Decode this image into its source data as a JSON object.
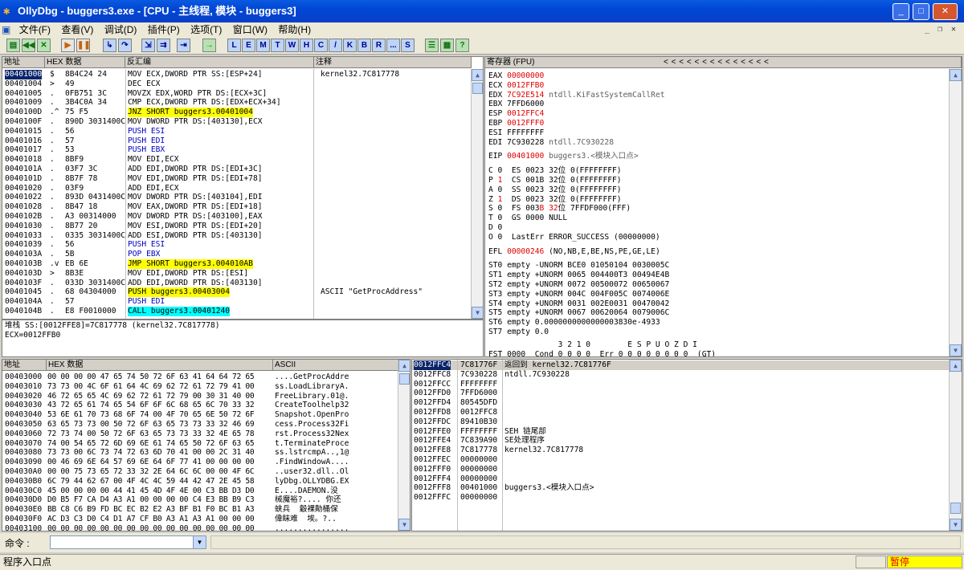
{
  "window": {
    "title": "OllyDbg - buggers3.exe - [CPU - 主线程, 模块 - buggers3]"
  },
  "menu": [
    "文件(F)",
    "查看(V)",
    "调试(D)",
    "插件(P)",
    "选项(T)",
    "窗口(W)",
    "帮助(H)"
  ],
  "toolbar_letters": [
    "L",
    "E",
    "M",
    "T",
    "W",
    "H",
    "C",
    "/",
    "K",
    "B",
    "R",
    "...",
    "S"
  ],
  "disasm": {
    "headers": {
      "addr": "地址",
      "hex": "HEX 数据",
      "dis": "反汇编",
      "cmt": "注释"
    },
    "rows": [
      {
        "addr": "00401000",
        "mk": "$",
        "hex": "8B4C24 24",
        "dis": "MOV ECX,DWORD PTR SS:[ESP+24]",
        "cmt": "kernel32.7C817778",
        "sel": true
      },
      {
        "addr": "00401004",
        "mk": ">",
        "hex": "49",
        "dis": "DEC ECX",
        "cmt": ""
      },
      {
        "addr": "00401005",
        "mk": ".",
        "hex": "0FB751 3C",
        "dis": "MOVZX EDX,WORD PTR DS:[ECX+3C]",
        "cmt": ""
      },
      {
        "addr": "00401009",
        "mk": ".",
        "hex": "3B4C0A 34",
        "dis": "CMP ECX,DWORD PTR DS:[EDX+ECX+34]",
        "cmt": ""
      },
      {
        "addr": "0040100D",
        "mk": ".^",
        "hex": "75 F5",
        "dis": "JNZ SHORT buggers3.00401004",
        "cmt": "",
        "hl": "y"
      },
      {
        "addr": "0040100F",
        "mk": ".",
        "hex": "890D 3031400C",
        "dis": "MOV DWORD PTR DS:[403130],ECX",
        "cmt": ""
      },
      {
        "addr": "00401015",
        "mk": ".",
        "hex": "56",
        "dis": "PUSH ESI",
        "cmt": "",
        "blue": true
      },
      {
        "addr": "00401016",
        "mk": ".",
        "hex": "57",
        "dis": "PUSH EDI",
        "cmt": "",
        "blue": true
      },
      {
        "addr": "00401017",
        "mk": ".",
        "hex": "53",
        "dis": "PUSH EBX",
        "cmt": "",
        "blue": true
      },
      {
        "addr": "00401018",
        "mk": ".",
        "hex": "8BF9",
        "dis": "MOV EDI,ECX",
        "cmt": ""
      },
      {
        "addr": "0040101A",
        "mk": ".",
        "hex": "03F7 3C",
        "dis": "ADD EDI,DWORD PTR DS:[EDI+3C]",
        "cmt": ""
      },
      {
        "addr": "0040101D",
        "mk": ".",
        "hex": "8B7F 78",
        "dis": "MOV EDI,DWORD PTR DS:[EDI+78]",
        "cmt": ""
      },
      {
        "addr": "00401020",
        "mk": ".",
        "hex": "03F9",
        "dis": "ADD EDI,ECX",
        "cmt": ""
      },
      {
        "addr": "00401022",
        "mk": ".",
        "hex": "893D 0431400C",
        "dis": "MOV DWORD PTR DS:[403104],EDI",
        "cmt": ""
      },
      {
        "addr": "00401028",
        "mk": ".",
        "hex": "8B47 18",
        "dis": "MOV EAX,DWORD PTR DS:[EDI+18]",
        "cmt": ""
      },
      {
        "addr": "0040102B",
        "mk": ".",
        "hex": "A3 00314000",
        "dis": "MOV DWORD PTR DS:[403100],EAX",
        "cmt": ""
      },
      {
        "addr": "00401030",
        "mk": ".",
        "hex": "8B77 20",
        "dis": "MOV ESI,DWORD PTR DS:[EDI+20]",
        "cmt": ""
      },
      {
        "addr": "00401033",
        "mk": ".",
        "hex": "0335 3031400C",
        "dis": "ADD ESI,DWORD PTR DS:[403130]",
        "cmt": ""
      },
      {
        "addr": "00401039",
        "mk": ".",
        "hex": "56",
        "dis": "PUSH ESI",
        "cmt": "",
        "blue": true
      },
      {
        "addr": "0040103A",
        "mk": ".",
        "hex": "5B",
        "dis": "POP EBX",
        "cmt": "",
        "blue": true
      },
      {
        "addr": "0040103B",
        "mk": ".v",
        "hex": "EB 6E",
        "dis": "JMP SHORT buggers3.004010AB",
        "cmt": "",
        "hl": "y"
      },
      {
        "addr": "0040103D",
        "mk": ">",
        "hex": "8B3E",
        "dis": "MOV EDI,DWORD PTR DS:[ESI]",
        "cmt": ""
      },
      {
        "addr": "0040103F",
        "mk": ".",
        "hex": "033D 3031400C",
        "dis": "ADD EDI,DWORD PTR DS:[403130]",
        "cmt": ""
      },
      {
        "addr": "00401045",
        "mk": ".",
        "hex": "68 04304000",
        "dis": "PUSH buggers3.00403004",
        "cmt": "ASCII \"GetProcAddress\"",
        "hl": "yp"
      },
      {
        "addr": "0040104A",
        "mk": ".",
        "hex": "57",
        "dis": "PUSH EDI",
        "cmt": "",
        "blue": true
      },
      {
        "addr": "0040104B",
        "mk": ".",
        "hex": "E8 F0010000",
        "dis": "CALL buggers3.00401240",
        "cmt": "",
        "hl": "c"
      }
    ]
  },
  "info": {
    "line1": "堆栈 SS:[0012FFE8]=7C817778 (kernel32.7C817778)",
    "line2": "ECX=0012FFB0"
  },
  "registers": {
    "header": "寄存器 (FPU)",
    "nav": "<   <   <   <   <   <   <   <   <   <   <   <   <   <",
    "gp": [
      {
        "n": "EAX",
        "v": "00000000",
        "c": "",
        "r": true
      },
      {
        "n": "ECX",
        "v": "0012FFB0",
        "c": "",
        "r": true
      },
      {
        "n": "EDX",
        "v": "7C92E514",
        "c": "ntdll.KiFastSystemCallRet",
        "r": true
      },
      {
        "n": "EBX",
        "v": "7FFD6000",
        "c": "",
        "r": false
      },
      {
        "n": "ESP",
        "v": "0012FFC4",
        "c": "",
        "r": true
      },
      {
        "n": "EBP",
        "v": "0012FFF0",
        "c": "",
        "r": true
      },
      {
        "n": "ESI",
        "v": "FFFFFFFF",
        "c": "",
        "r": false
      },
      {
        "n": "EDI",
        "v": "7C930228",
        "c": "ntdll.7C930228",
        "r": false
      }
    ],
    "eip": {
      "n": "EIP",
      "v": "00401000",
      "c": "buggers3.<模块入口点>"
    },
    "flags": [
      "C 0  ES 0023 32位 0(FFFFFFFF)",
      "P 1  CS 001B 32位 0(FFFFFFFF)",
      "A 0  SS 0023 32位 0(FFFFFFFF)",
      "Z 1  DS 0023 32位 0(FFFFFFFF)",
      "S 0  FS 003B 32位 7FFDF000(FFF)",
      "T 0  GS 0000 NULL",
      "D 0",
      "O 0  LastErr ERROR_SUCCESS (00000000)"
    ],
    "efl": {
      "n": "EFL",
      "v": "00000246",
      "c": "(NO,NB,E,BE,NS,PE,GE,LE)"
    },
    "fpu": [
      "ST0 empty -UNORM BCE0 01050104 0030005C",
      "ST1 empty +UNORM 0065 004400T3 00494E4B",
      "ST2 empty +UNORM 0072 00500072 00650067",
      "ST3 empty +UNORM 004C 004F005C 0074006E",
      "ST4 empty +UNORM 0031 002E0031 00470042",
      "ST5 empty +UNORM 0067 00620064 0079006C",
      "ST6 empty 0.0000000000000003830e-4933",
      "ST7 empty 0.0"
    ],
    "fst_top": "               3 2 1 0        E S P U O Z D I",
    "fst": "FST 0000  Cond 0 0 0 0  Err 0 0 0 0 0 0 0 0  (GT)"
  },
  "dump": {
    "headers": {
      "addr": "地址",
      "hex": "HEX 数据",
      "ascii": "ASCII"
    },
    "rows": [
      {
        "a": "00403000",
        "h": "00 00 00 00 47 65 74 50 72 6F 63 41 64 64 72 65",
        "s": "....GetProcAddre"
      },
      {
        "a": "00403010",
        "h": "73 73 00 4C 6F 61 64 4C 69 62 72 61 72 79 41 00",
        "s": "ss.LoadLibraryA."
      },
      {
        "a": "00403020",
        "h": "46 72 65 65 4C 69 62 72 61 72 79 00 30 31 40 00",
        "s": "FreeLibrary.01@."
      },
      {
        "a": "00403030",
        "h": "43 72 65 61 74 65 54 6F 6F 6C 68 65 6C 70 33 32",
        "s": "CreateToolhelp32"
      },
      {
        "a": "00403040",
        "h": "53 6E 61 70 73 68 6F 74 00 4F 70 65 6E 50 72 6F",
        "s": "Snapshot.OpenPro"
      },
      {
        "a": "00403050",
        "h": "63 65 73 73 00 50 72 6F 63 65 73 73 33 32 46 69",
        "s": "cess.Process32Fi"
      },
      {
        "a": "00403060",
        "h": "72 73 74 00 50 72 6F 63 65 73 73 33 32 4E 65 78",
        "s": "rst.Process32Nex"
      },
      {
        "a": "00403070",
        "h": "74 00 54 65 72 6D 69 6E 61 74 65 50 72 6F 63 65",
        "s": "t.TerminateProce"
      },
      {
        "a": "00403080",
        "h": "73 73 00 6C 73 74 72 63 6D 70 41 00 00 2C 31 40",
        "s": "ss.lstrcmpA..,1@"
      },
      {
        "a": "00403090",
        "h": "00 46 69 6E 64 57 69 6E 64 6F 77 41 00 00 00 00",
        "s": ".FindWindowA...."
      },
      {
        "a": "004030A0",
        "h": "00 00 75 73 65 72 33 32 2E 64 6C 6C 00 00 4F 6C",
        "s": "..user32.dll..Ol"
      },
      {
        "a": "004030B0",
        "h": "6C 79 44 62 67 00 4F 4C 4C 59 44 42 47 2E 45 58",
        "s": "lyDbg.OLLYDBG.EX"
      },
      {
        "a": "004030C0",
        "h": "45 00 00 00 00 44 41 45 4D 4F 4E 00 C3 BB D3 D0",
        "s": "E....DAEMON.没"
      },
      {
        "a": "004030D0",
        "h": "D0 B5 F7 CA D4 A3 A1 00 00 00 00 C4 E3 BB B9 C3",
        "s": "械魔裕?.... 你还"
      },
      {
        "a": "004030E0",
        "h": "BB C8 C6 B9 FD BC EC B2 E2 A3 BF B1 F0 BC B1 A3",
        "s": "蛱兵  觳裸勣桶保"
      },
      {
        "a": "004030F0",
        "h": "AC D3 C3 D0 C4 D1 A7 CF B0 A3 A1 A3 A1 00 00 00",
        "s": "偉眛难  埃。?.."
      },
      {
        "a": "00403100",
        "h": "00 00 00 00 00 00 00 00 00 00 00 00 00 00 00 00",
        "s": "................"
      }
    ]
  },
  "stack": {
    "rows": [
      {
        "a": "0012FFC4",
        "v": "7C81776F",
        "c": "返回到 kernel32.7C81776F",
        "sel": true
      },
      {
        "a": "0012FFC8",
        "v": "7C930228",
        "c": "ntdll.7C930228"
      },
      {
        "a": "0012FFCC",
        "v": "FFFFFFFF",
        "c": ""
      },
      {
        "a": "0012FFD0",
        "v": "7FFD6000",
        "c": ""
      },
      {
        "a": "0012FFD4",
        "v": "80545DFD",
        "c": ""
      },
      {
        "a": "0012FFD8",
        "v": "0012FFC8",
        "c": ""
      },
      {
        "a": "0012FFDC",
        "v": "89410B30",
        "c": ""
      },
      {
        "a": "0012FFE0",
        "v": "FFFFFFFF",
        "c": "SEH 链尾部"
      },
      {
        "a": "0012FFE4",
        "v": "7C839A90",
        "c": "SE处理程序"
      },
      {
        "a": "0012FFE8",
        "v": "7C817778",
        "c": "kernel32.7C817778"
      },
      {
        "a": "0012FFEC",
        "v": "00000000",
        "c": ""
      },
      {
        "a": "0012FFF0",
        "v": "00000000",
        "c": ""
      },
      {
        "a": "0012FFF4",
        "v": "00000000",
        "c": ""
      },
      {
        "a": "0012FFF8",
        "v": "00401000",
        "c": "buggers3.<模块入口点>"
      },
      {
        "a": "0012FFFC",
        "v": "00000000",
        "c": ""
      }
    ]
  },
  "command": {
    "label": "命令 :"
  },
  "status": {
    "left": "程序入口点",
    "right": "暂停",
    "right_color": "#ffff00"
  }
}
